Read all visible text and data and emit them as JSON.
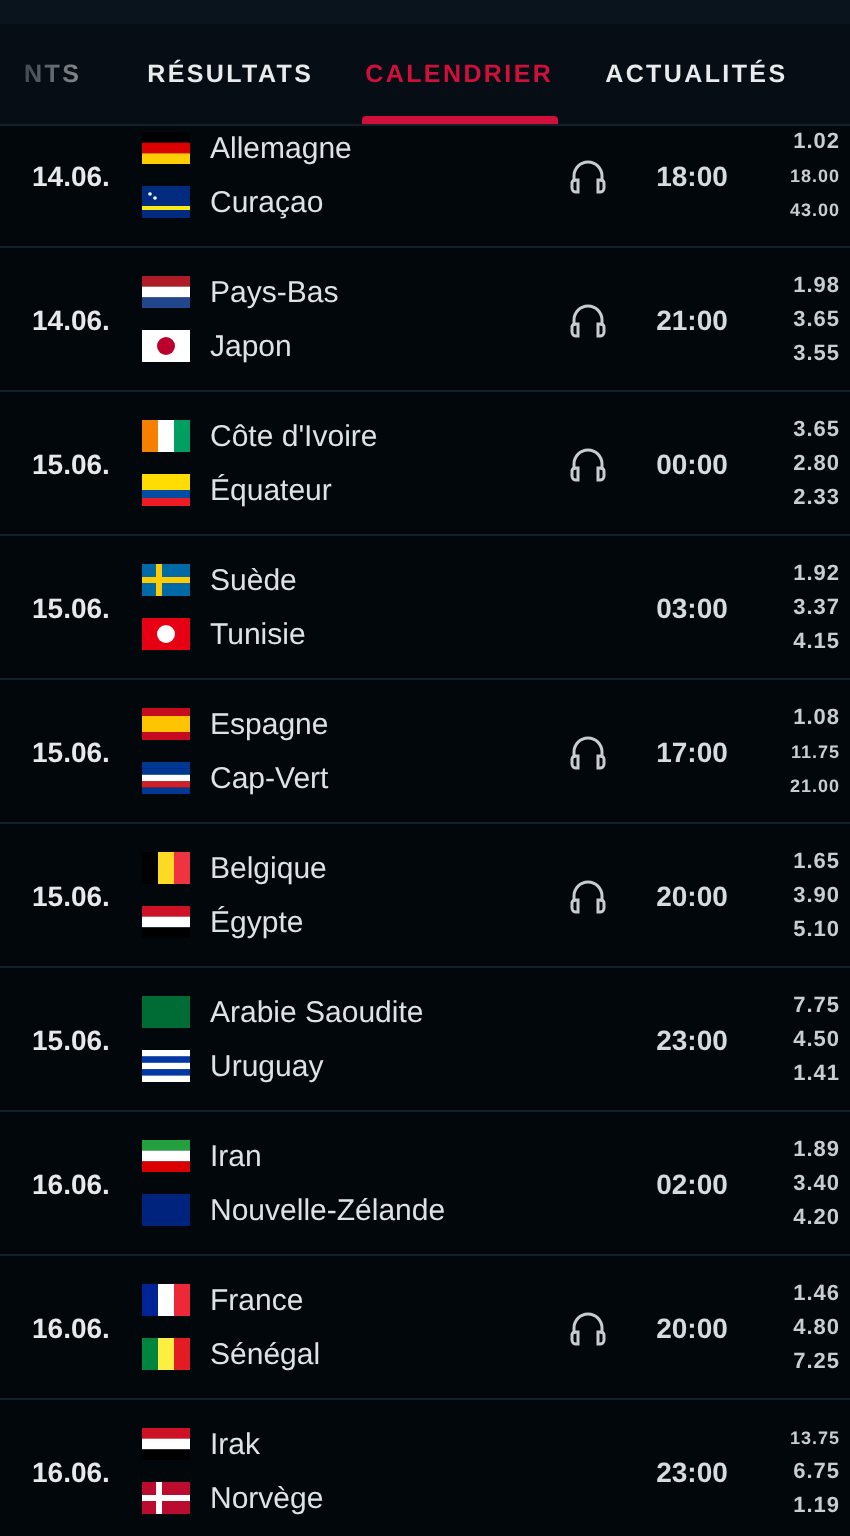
{
  "tabs": [
    {
      "label": "NTS",
      "selected": false
    },
    {
      "label": "RÉSULTATS",
      "selected": false
    },
    {
      "label": "CALENDRIER",
      "selected": true
    },
    {
      "label": "ACTUALITÉS",
      "selected": false
    }
  ],
  "matches": [
    {
      "date": "14.06.",
      "teams": [
        {
          "name": "Allemagne"
        },
        {
          "name": "Curaçao"
        }
      ],
      "audio": true,
      "time": "18:00",
      "odds": [
        "1.02",
        "18.00",
        "43.00"
      ]
    },
    {
      "date": "14.06.",
      "teams": [
        {
          "name": "Pays-Bas"
        },
        {
          "name": "Japon"
        }
      ],
      "audio": true,
      "time": "21:00",
      "odds": [
        "1.98",
        "3.65",
        "3.55"
      ]
    },
    {
      "date": "15.06.",
      "teams": [
        {
          "name": "Côte d'Ivoire"
        },
        {
          "name": "Équateur"
        }
      ],
      "audio": true,
      "time": "00:00",
      "odds": [
        "3.65",
        "2.80",
        "2.33"
      ]
    },
    {
      "date": "15.06.",
      "teams": [
        {
          "name": "Suède"
        },
        {
          "name": "Tunisie"
        }
      ],
      "audio": false,
      "time": "03:00",
      "odds": [
        "1.92",
        "3.37",
        "4.15"
      ]
    },
    {
      "date": "15.06.",
      "teams": [
        {
          "name": "Espagne"
        },
        {
          "name": "Cap-Vert"
        }
      ],
      "audio": true,
      "time": "17:00",
      "odds": [
        "1.08",
        "11.75",
        "21.00"
      ]
    },
    {
      "date": "15.06.",
      "teams": [
        {
          "name": "Belgique"
        },
        {
          "name": "Égypte"
        }
      ],
      "audio": true,
      "time": "20:00",
      "odds": [
        "1.65",
        "3.90",
        "5.10"
      ]
    },
    {
      "date": "15.06.",
      "teams": [
        {
          "name": "Arabie Saoudite"
        },
        {
          "name": "Uruguay"
        }
      ],
      "audio": false,
      "time": "23:00",
      "odds": [
        "7.75",
        "4.50",
        "1.41"
      ]
    },
    {
      "date": "16.06.",
      "teams": [
        {
          "name": "Iran"
        },
        {
          "name": "Nouvelle-Zélande"
        }
      ],
      "audio": false,
      "time": "02:00",
      "odds": [
        "1.89",
        "3.40",
        "4.20"
      ]
    },
    {
      "date": "16.06.",
      "teams": [
        {
          "name": "France"
        },
        {
          "name": "Sénégal"
        }
      ],
      "audio": true,
      "time": "20:00",
      "odds": [
        "1.46",
        "4.80",
        "7.25"
      ]
    },
    {
      "date": "16.06.",
      "teams": [
        {
          "name": "Irak"
        },
        {
          "name": "Norvège"
        }
      ],
      "audio": false,
      "time": "23:00",
      "odds": [
        "13.75",
        "6.75",
        "1.19"
      ]
    }
  ]
}
